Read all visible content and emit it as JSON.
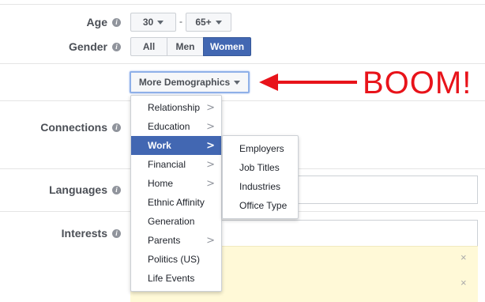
{
  "age": {
    "label": "Age",
    "min": "30",
    "separator": "-",
    "max": "65+"
  },
  "gender": {
    "label": "Gender",
    "options": [
      "All",
      "Men",
      "Women"
    ],
    "selected": "Women"
  },
  "more_demographics": {
    "label": "More Demographics"
  },
  "annotation": {
    "text": "BOOM!",
    "color": "#e8131a"
  },
  "sections": {
    "connections": "Connections",
    "languages": "Languages",
    "interests": "Interests"
  },
  "demographics_menu": {
    "items": [
      {
        "label": "Relationship",
        "has_submenu": true
      },
      {
        "label": "Education",
        "has_submenu": true
      },
      {
        "label": "Work",
        "has_submenu": true,
        "highlighted": true
      },
      {
        "label": "Financial",
        "has_submenu": true
      },
      {
        "label": "Home",
        "has_submenu": true
      },
      {
        "label": "Ethnic Affinity",
        "has_submenu": false
      },
      {
        "label": "Generation",
        "has_submenu": false
      },
      {
        "label": "Parents",
        "has_submenu": true
      },
      {
        "label": "Politics (US)",
        "has_submenu": false
      },
      {
        "label": "Life Events",
        "has_submenu": false
      }
    ],
    "chevron": ">"
  },
  "work_submenu": {
    "items": [
      "Employers",
      "Job Titles",
      "Industries",
      "Office Type"
    ]
  },
  "remove_glyph": "×",
  "colors": {
    "accent": "#4267b2",
    "highlight_bg": "#fff9d7",
    "annotation_red": "#e8131a"
  }
}
